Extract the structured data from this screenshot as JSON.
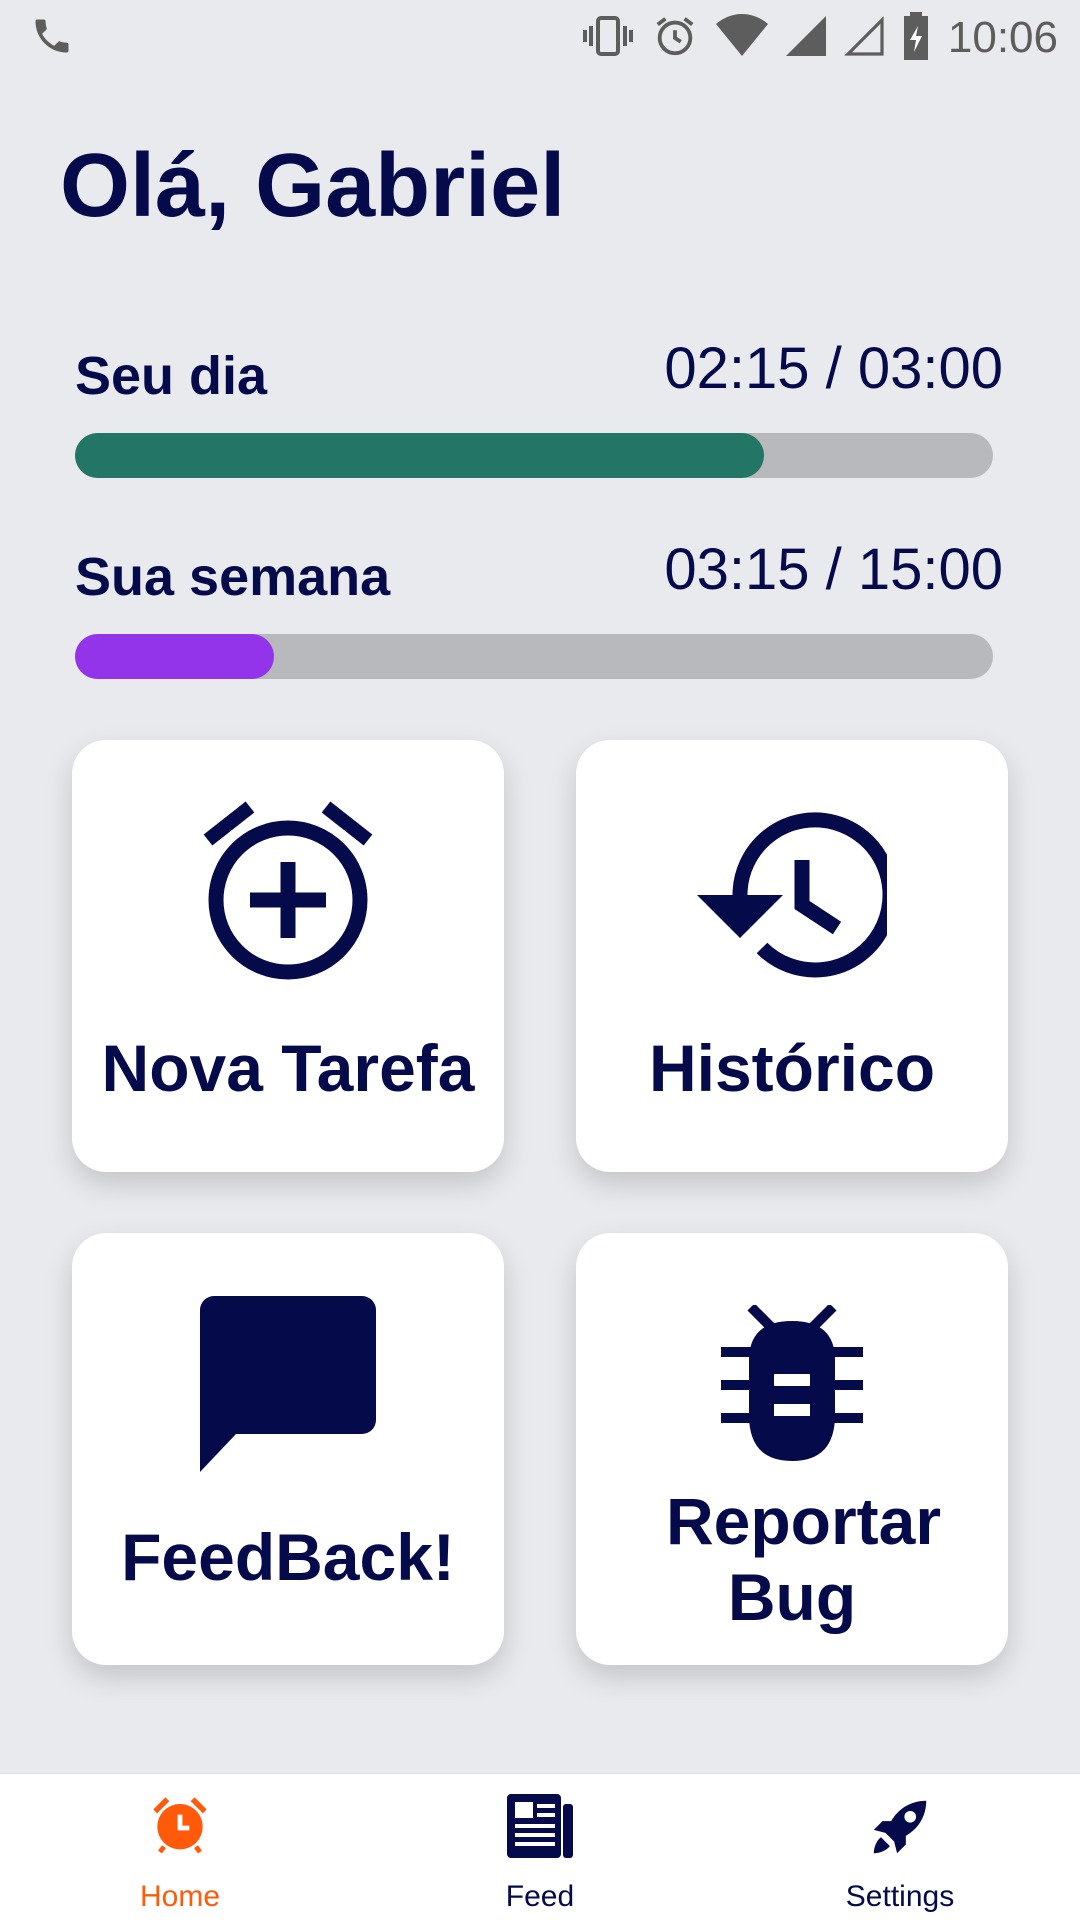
{
  "status_bar": {
    "time": "10:06",
    "icons": [
      "phone-icon",
      "vibrate-icon",
      "alarm-icon",
      "wifi-icon",
      "signal-icon",
      "signal-empty-icon",
      "battery-charging-icon"
    ]
  },
  "greeting": "Olá, Gabriel",
  "progress": [
    {
      "label": "Seu dia",
      "value_text": "02:15 / 03:00",
      "fraction": 0.75,
      "color": "#237566"
    },
    {
      "label": "Sua semana",
      "value_text": "03:15 / 15:00",
      "fraction": 0.217,
      "color": "#9333ea"
    }
  ],
  "cards": [
    {
      "label": "Nova Tarefa",
      "icon": "alarm-add-icon"
    },
    {
      "label": "Histórico",
      "icon": "history-icon"
    },
    {
      "label": "FeedBack!",
      "icon": "chat-bubble-icon"
    },
    {
      "label": "Reportar Bug",
      "icon": "bug-icon"
    }
  ],
  "bottom_nav": {
    "items": [
      {
        "label": "Home",
        "icon": "alarm-clock-icon",
        "active": true
      },
      {
        "label": "Feed",
        "icon": "newspaper-icon",
        "active": false
      },
      {
        "label": "Settings",
        "icon": "rocket-icon",
        "active": false
      }
    ],
    "active_color": "#ff5a0a",
    "inactive_color": "#050a4a"
  },
  "colors": {
    "primary": "#050a4a",
    "background": "#e9eaee",
    "track": "#b8b9bd"
  }
}
